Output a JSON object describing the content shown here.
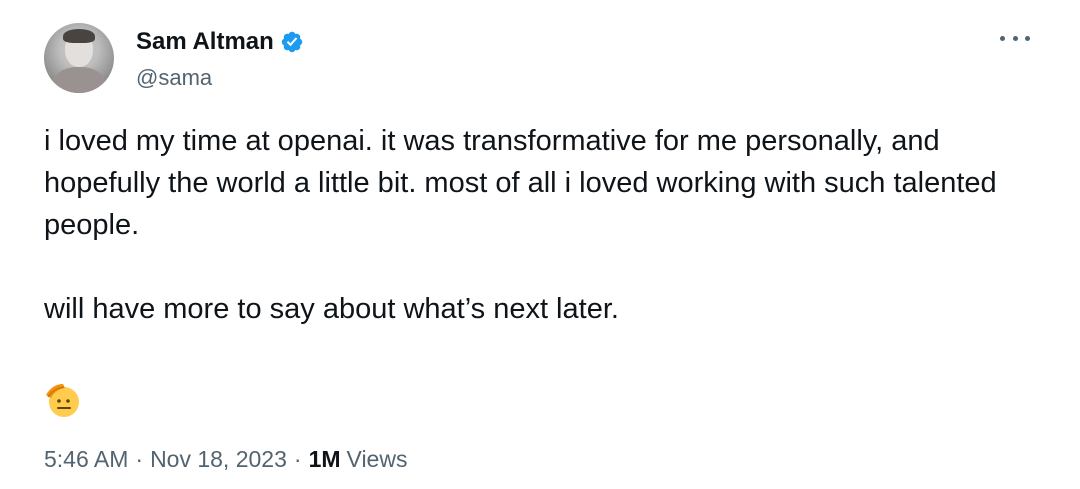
{
  "author": {
    "display_name": "Sam Altman",
    "handle": "@sama",
    "verified_icon": "verified-badge-icon"
  },
  "tweet": {
    "paragraphs": [
      "i loved my time at openai. it was transformative for me personally, and hopefully the world a little bit. most of all i loved working with such talented people.",
      "will have more to say about what’s next later."
    ],
    "emoji": "saluting-face"
  },
  "meta": {
    "time": "5:46 AM",
    "separator": "·",
    "date": "Nov 18, 2023",
    "views_count": "1M",
    "views_label": "Views"
  },
  "colors": {
    "text": "#0f1419",
    "secondary": "#536471",
    "verified": "#1d9bf0",
    "background": "#ffffff"
  }
}
